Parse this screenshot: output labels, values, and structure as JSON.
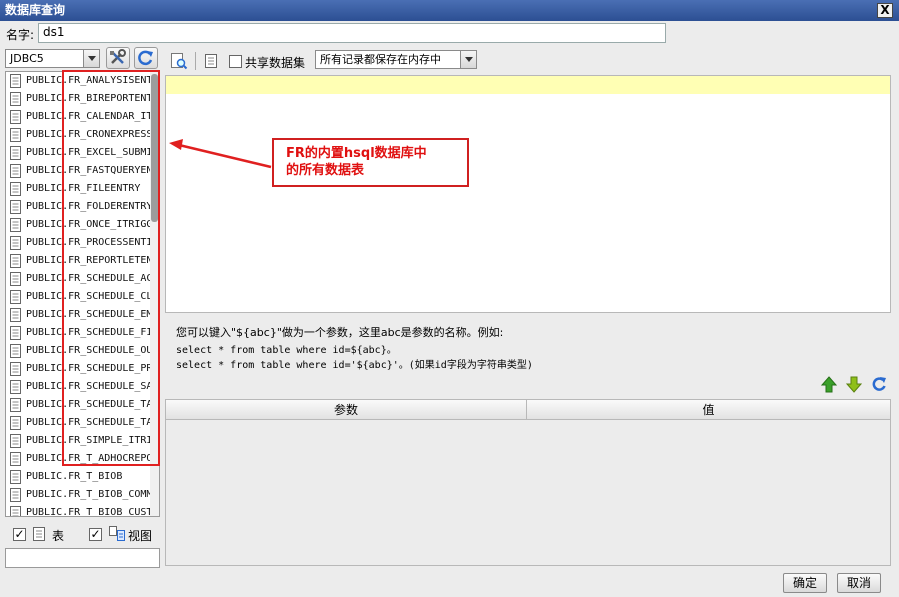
{
  "window": {
    "title": "数据库查询",
    "close_glyph": "X"
  },
  "name_field": {
    "label": "名字:",
    "value": "ds1"
  },
  "connection": {
    "selected": "JDBC5"
  },
  "toolbar": {
    "share_dataset_label": "共享数据集",
    "storage_mode": "所有记录都保存在内存中"
  },
  "tables": [
    {
      "schema": "PUBLIC.",
      "name": "FR_ANALYSISENT"
    },
    {
      "schema": "PUBLIC.",
      "name": "FR_BIREPORTENT"
    },
    {
      "schema": "PUBLIC.",
      "name": "FR_CALENDAR_IT"
    },
    {
      "schema": "PUBLIC.",
      "name": "FR_CRONEXPRESS"
    },
    {
      "schema": "PUBLIC.",
      "name": "FR_EXCEL_SUBMI"
    },
    {
      "schema": "PUBLIC.",
      "name": "FR_FASTQUERYEN"
    },
    {
      "schema": "PUBLIC.",
      "name": "FR_FILEENTRY"
    },
    {
      "schema": "PUBLIC.",
      "name": "FR_FOLDERENTRY"
    },
    {
      "schema": "PUBLIC.",
      "name": "FR_ONCE_ITRIGG"
    },
    {
      "schema": "PUBLIC.",
      "name": "FR_PROCESSENTI"
    },
    {
      "schema": "PUBLIC.",
      "name": "FR_REPORTLETEN"
    },
    {
      "schema": "PUBLIC.",
      "name": "FR_SCHEDULE_AC"
    },
    {
      "schema": "PUBLIC.",
      "name": "FR_SCHEDULE_CL"
    },
    {
      "schema": "PUBLIC.",
      "name": "FR_SCHEDULE_EM"
    },
    {
      "schema": "PUBLIC.",
      "name": "FR_SCHEDULE_FI"
    },
    {
      "schema": "PUBLIC.",
      "name": "FR_SCHEDULE_OU"
    },
    {
      "schema": "PUBLIC.",
      "name": "FR_SCHEDULE_PR"
    },
    {
      "schema": "PUBLIC.",
      "name": "FR_SCHEDULE_SA"
    },
    {
      "schema": "PUBLIC.",
      "name": "FR_SCHEDULE_TA"
    },
    {
      "schema": "PUBLIC.",
      "name": "FR_SCHEDULE_TA"
    },
    {
      "schema": "PUBLIC.",
      "name": "FR_SIMPLE_ITRI"
    },
    {
      "schema": "PUBLIC.",
      "name": "FR_T_ADHOCREPO"
    },
    {
      "schema": "PUBLIC.",
      "name": "FR_T_BIOB"
    },
    {
      "schema": "PUBLIC.",
      "name": "FR_T_BIOB_COMM"
    },
    {
      "schema": "PUBLIC.",
      "name": "FR_T_BIOB_CUST"
    }
  ],
  "filters": {
    "table_label": "表",
    "view_label": "视图"
  },
  "annotation": {
    "line1": "FR的内置hsql数据库中",
    "line2": "的所有数据表"
  },
  "hint": {
    "line1": "您可以键入\"${abc}\"做为一个参数，这里abc是参数的名称。例如:",
    "line2": "select * from table where id=${abc}。",
    "line3": "select * from table where id='${abc}'。(如果id字段为字符串类型)"
  },
  "params": {
    "col_param": "参数",
    "col_value": "值"
  },
  "buttons": {
    "ok": "确定",
    "cancel": "取消"
  },
  "colors": {
    "title_bar": "#2c4f93",
    "annotation_red": "#e02020",
    "sql_highlight": "#ffffb4",
    "arrow_up_green": "#3aa02a"
  }
}
